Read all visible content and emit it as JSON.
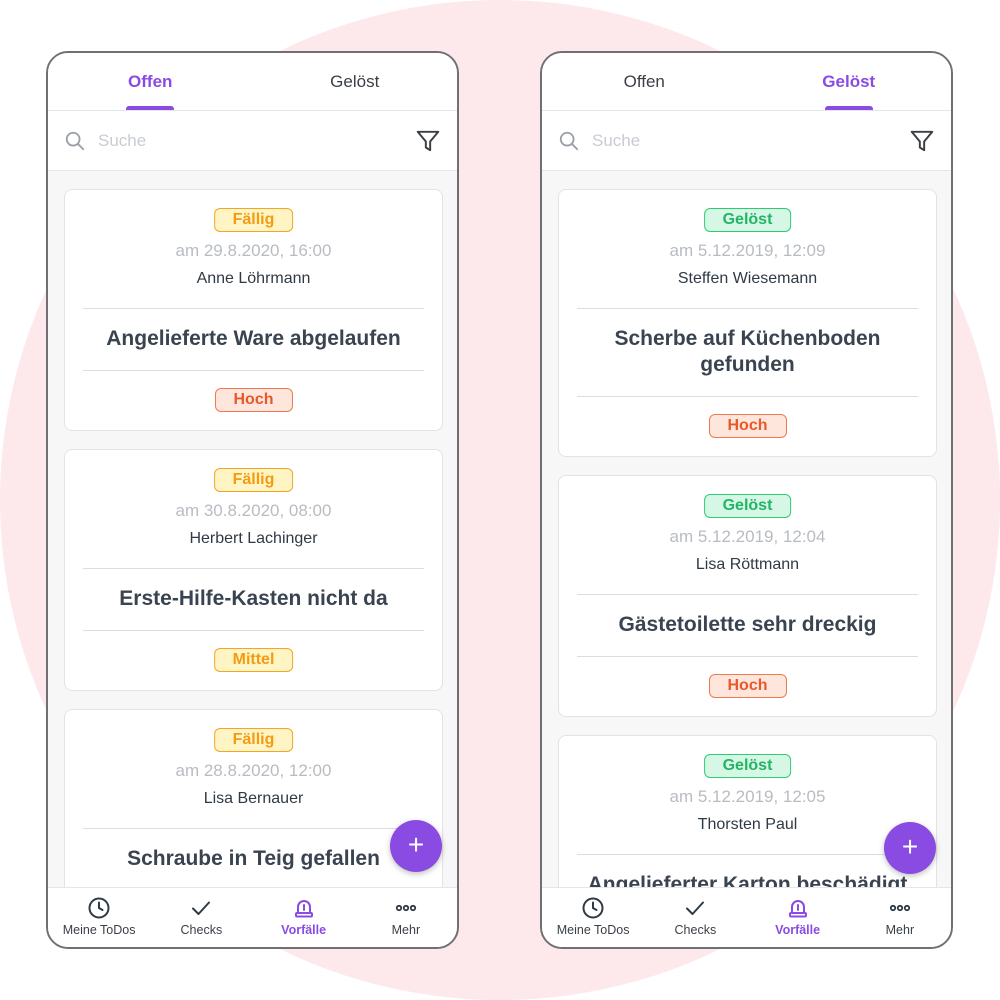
{
  "colors": {
    "accent": "#8a4be3",
    "background_circle": "#fde8ec",
    "due_badge": "#f39c12",
    "solved_badge": "#22b565",
    "high_priority": "#e8582a"
  },
  "left_screen": {
    "tabs": [
      "Offen",
      "Gelöst"
    ],
    "active_tab": "Offen",
    "search": {
      "placeholder": "Suche"
    },
    "cards": [
      {
        "status": "Fällig",
        "date": "am 29.8.2020, 16:00",
        "person": "Anne Löhrmann",
        "title": "Angelieferte Ware abgelaufen",
        "priority": "Hoch"
      },
      {
        "status": "Fällig",
        "date": "am 30.8.2020, 08:00",
        "person": "Herbert Lachinger",
        "title": "Erste-Hilfe-Kasten nicht da",
        "priority": "Mittel"
      },
      {
        "status": "Fällig",
        "date": "am 28.8.2020, 12:00",
        "person": "Lisa Bernauer",
        "title": "Schraube in Teig gefallen",
        "priority": ""
      }
    ],
    "fab": "+",
    "nav": [
      {
        "label": "Meine ToDos",
        "icon": "clock-icon"
      },
      {
        "label": "Checks",
        "icon": "check-icon"
      },
      {
        "label": "Vorfälle",
        "icon": "alarm-bell-icon"
      },
      {
        "label": "Mehr",
        "icon": "more-dots-icon"
      }
    ],
    "active_nav": "Vorfälle"
  },
  "right_screen": {
    "tabs": [
      "Offen",
      "Gelöst"
    ],
    "active_tab": "Gelöst",
    "search": {
      "placeholder": "Suche"
    },
    "cards": [
      {
        "status": "Gelöst",
        "date": "am 5.12.2019, 12:09",
        "person": "Steffen Wiesemann",
        "title": "Scherbe auf Küchenboden gefunden",
        "priority": "Hoch"
      },
      {
        "status": "Gelöst",
        "date": "am 5.12.2019, 12:04",
        "person": "Lisa Röttmann",
        "title": "Gästetoilette sehr dreckig",
        "priority": "Hoch"
      },
      {
        "status": "Gelöst",
        "date": "am 5.12.2019, 12:05",
        "person": "Thorsten Paul",
        "title": "Angelieferter Karton beschädigt",
        "priority": ""
      }
    ],
    "fab": "+",
    "nav": [
      {
        "label": "Meine ToDos",
        "icon": "clock-icon"
      },
      {
        "label": "Checks",
        "icon": "check-icon"
      },
      {
        "label": "Vorfälle",
        "icon": "alarm-bell-icon"
      },
      {
        "label": "Mehr",
        "icon": "more-dots-icon"
      }
    ],
    "active_nav": "Vorfälle"
  }
}
